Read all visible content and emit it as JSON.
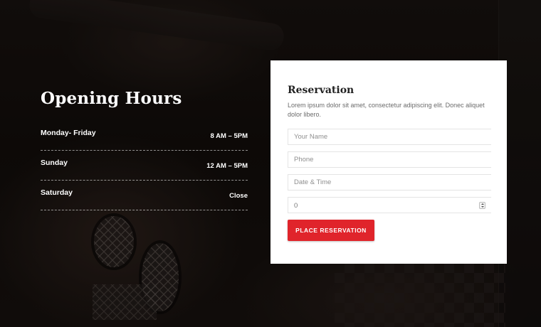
{
  "opening_hours": {
    "title": "Opening Hours",
    "rows": [
      {
        "day": "Monday- Friday",
        "time": "8 AM – 5PM"
      },
      {
        "day": "Sunday",
        "time": "12 AM – 5PM"
      },
      {
        "day": "Saturday",
        "time": "Close"
      }
    ]
  },
  "reservation": {
    "title": "Reservation",
    "description": "Lorem ipsum dolor sit amet, consectetur adipiscing elit. Donec aliquet dolor libero.",
    "fields": {
      "name_placeholder": "Your Name",
      "phone_placeholder": "Phone",
      "datetime_placeholder": "Date & Time",
      "guests_value": "0"
    },
    "submit_label": "PLACE RESERVATION"
  },
  "colors": {
    "accent": "#e0242b",
    "card_background": "#ffffff",
    "page_background": "#140f0d"
  },
  "icons": [
    "number-spinner-icon"
  ]
}
